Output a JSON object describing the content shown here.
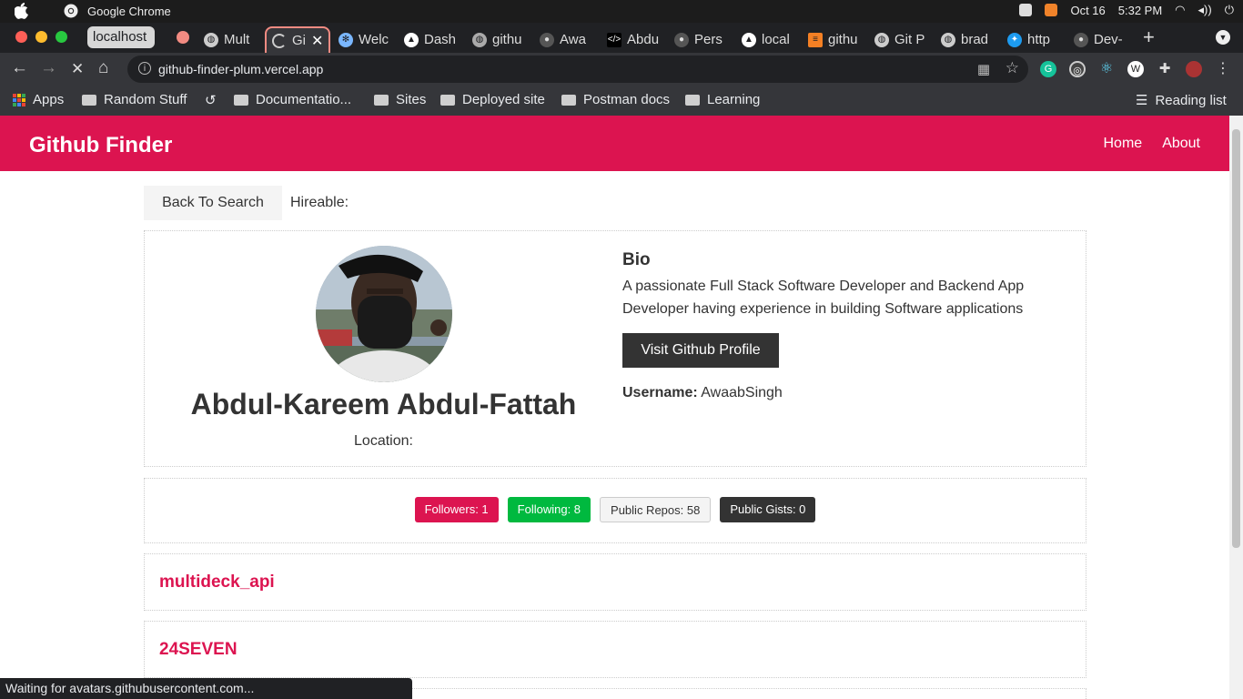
{
  "os_bar": {
    "app_name": "Google Chrome",
    "date": "Oct 16",
    "time": "5:32 PM"
  },
  "tabs": {
    "group_label": "localhost",
    "items": [
      {
        "label": "Mult",
        "icon": "globe-icon"
      },
      {
        "label": "Gi",
        "icon": "loading-spinner-icon",
        "active": true
      },
      {
        "label": "Welc",
        "icon": "welcome-icon"
      },
      {
        "label": "Dash",
        "icon": "vercel-icon"
      },
      {
        "label": "githu",
        "icon": "globe-icon"
      },
      {
        "label": "Awa",
        "icon": "github-icon"
      },
      {
        "label": "Abdu",
        "icon": "code-icon"
      },
      {
        "label": "Pers",
        "icon": "github-icon"
      },
      {
        "label": "local",
        "icon": "vercel-icon"
      },
      {
        "label": "githu",
        "icon": "stackoverflow-icon"
      },
      {
        "label": "Git P",
        "icon": "globe-icon"
      },
      {
        "label": "brad",
        "icon": "globe-icon"
      },
      {
        "label": "http",
        "icon": "twitter-icon"
      },
      {
        "label": "Dev-",
        "icon": "github-icon"
      }
    ]
  },
  "toolbar": {
    "url": "github-finder-plum.vercel.app"
  },
  "bookmarks": {
    "items": [
      "Apps",
      "Random Stuff",
      "Documentatio...",
      "Sites",
      "Deployed site",
      "Postman docs",
      "Learning"
    ],
    "reading_list": "Reading list"
  },
  "app": {
    "brand": "Github Finder",
    "nav": {
      "home": "Home",
      "about": "About"
    },
    "back_label": "Back To Search",
    "hireable_label": "Hireable:",
    "profile": {
      "name": "Abdul-Kareem Abdul-Fattah",
      "location_label": "Location:",
      "bio_title": "Bio",
      "bio": "A passionate Full Stack Software Developer and Backend App Developer having experience in building Software applications",
      "visit_label": "Visit Github Profile",
      "username_label": "Username:",
      "username": "AwaabSingh"
    },
    "stats": {
      "followers": "Followers: 1",
      "following": "Following: 8",
      "repos": "Public Repos: 58",
      "gists": "Public Gists: 0"
    },
    "repos": [
      "multideck_api",
      "24SEVEN"
    ]
  },
  "status_text": "Waiting for avatars.githubusercontent.com...",
  "colors": {
    "brand": "#dc1450",
    "success": "#00b93f",
    "dark": "#333333",
    "light": "#f4f4f4"
  }
}
